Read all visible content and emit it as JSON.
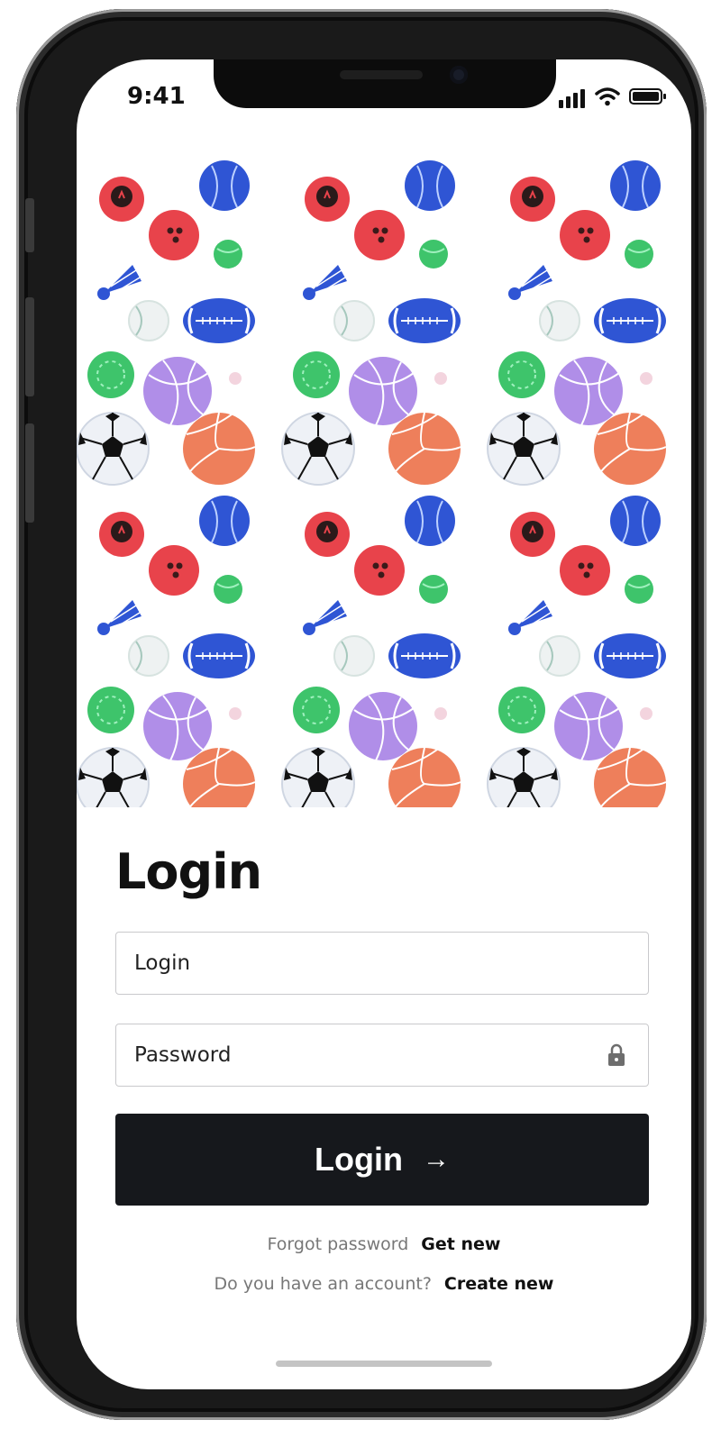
{
  "status_bar": {
    "time": "9:41"
  },
  "login_form": {
    "title": "Login",
    "login_placeholder": "Login",
    "password_placeholder": "Password",
    "submit_label": "Login",
    "submit_icon": "arrow-right-icon",
    "forgot_text": "Forgot password",
    "forgot_link": "Get new",
    "account_text": "Do you have an account?",
    "account_link": "Create new"
  },
  "colors": {
    "button_bg": "#16181c",
    "ball_red": "#e8434b",
    "ball_blue": "#2f55d4",
    "ball_green": "#3ec46b",
    "ball_purple": "#b08ee8",
    "ball_orange": "#ee7f5b"
  },
  "pattern_icons": [
    "bowling-ball-red-icon",
    "bowling-ball-icon",
    "baseball-blue-icon",
    "tennis-ball-icon",
    "shuttlecock-icon",
    "baseball-white-icon",
    "rugby-ball-icon",
    "lacrosse-ball-icon",
    "basketball-icon",
    "golf-ball-icon",
    "soccer-ball-icon",
    "volleyball-icon"
  ]
}
